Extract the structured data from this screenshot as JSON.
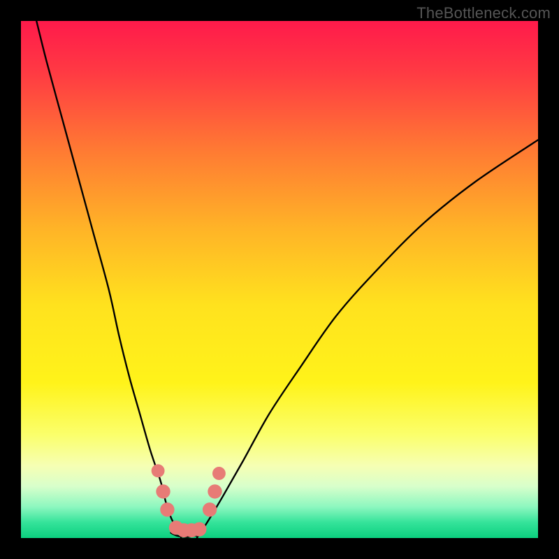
{
  "watermark": "TheBottleneck.com",
  "chart_data": {
    "type": "line",
    "title": "",
    "xlabel": "",
    "ylabel": "",
    "xlim": [
      0,
      100
    ],
    "ylim": [
      0,
      100
    ],
    "note": "Axes unlabeled; values are read from pixel positions. Background gradient maps y from red (top, high bottleneck) to green (bottom, low bottleneck). Two black curves descend into a central valley. Small salmon markers cluster near the valley bottom.",
    "gradient_stops": [
      {
        "pct": 0,
        "color": "#ff1a4b"
      },
      {
        "pct": 10,
        "color": "#ff3a43"
      },
      {
        "pct": 25,
        "color": "#ff7a33"
      },
      {
        "pct": 40,
        "color": "#ffb327"
      },
      {
        "pct": 55,
        "color": "#ffe21e"
      },
      {
        "pct": 70,
        "color": "#fff31a"
      },
      {
        "pct": 80,
        "color": "#fbff6b"
      },
      {
        "pct": 86,
        "color": "#f6ffb3"
      },
      {
        "pct": 90,
        "color": "#d8ffcb"
      },
      {
        "pct": 94,
        "color": "#8cf7bf"
      },
      {
        "pct": 97,
        "color": "#34e39a"
      },
      {
        "pct": 100,
        "color": "#0cd07f"
      }
    ],
    "series": [
      {
        "name": "left-curve",
        "x": [
          3,
          5,
          8,
          11,
          14,
          17,
          19,
          21,
          23,
          25,
          27,
          28,
          29,
          30,
          31
        ],
        "y": [
          100,
          92,
          81,
          70,
          59,
          48,
          39,
          31,
          24,
          17,
          11,
          7,
          4,
          2,
          0
        ]
      },
      {
        "name": "right-curve",
        "x": [
          34,
          36,
          39,
          43,
          48,
          54,
          61,
          69,
          78,
          88,
          100
        ],
        "y": [
          0,
          3,
          8,
          15,
          24,
          33,
          43,
          52,
          61,
          69,
          77
        ]
      },
      {
        "name": "valley-floor",
        "x": [
          29,
          30,
          31,
          32,
          33,
          34,
          35
        ],
        "y": [
          1,
          0.5,
          0.3,
          0.2,
          0.3,
          0.5,
          1
        ]
      }
    ],
    "markers": [
      {
        "x": 26.5,
        "y": 13,
        "r": 1.2
      },
      {
        "x": 27.5,
        "y": 9,
        "r": 1.4
      },
      {
        "x": 28.3,
        "y": 5.5,
        "r": 1.4
      },
      {
        "x": 30.0,
        "y": 2.0,
        "r": 1.4
      },
      {
        "x": 31.5,
        "y": 1.5,
        "r": 1.4
      },
      {
        "x": 33.0,
        "y": 1.5,
        "r": 1.4
      },
      {
        "x": 34.5,
        "y": 1.7,
        "r": 1.4
      },
      {
        "x": 36.5,
        "y": 5.5,
        "r": 1.4
      },
      {
        "x": 37.5,
        "y": 9.0,
        "r": 1.4
      },
      {
        "x": 38.3,
        "y": 12.5,
        "r": 1.2
      }
    ],
    "marker_color": "#e77b76"
  }
}
